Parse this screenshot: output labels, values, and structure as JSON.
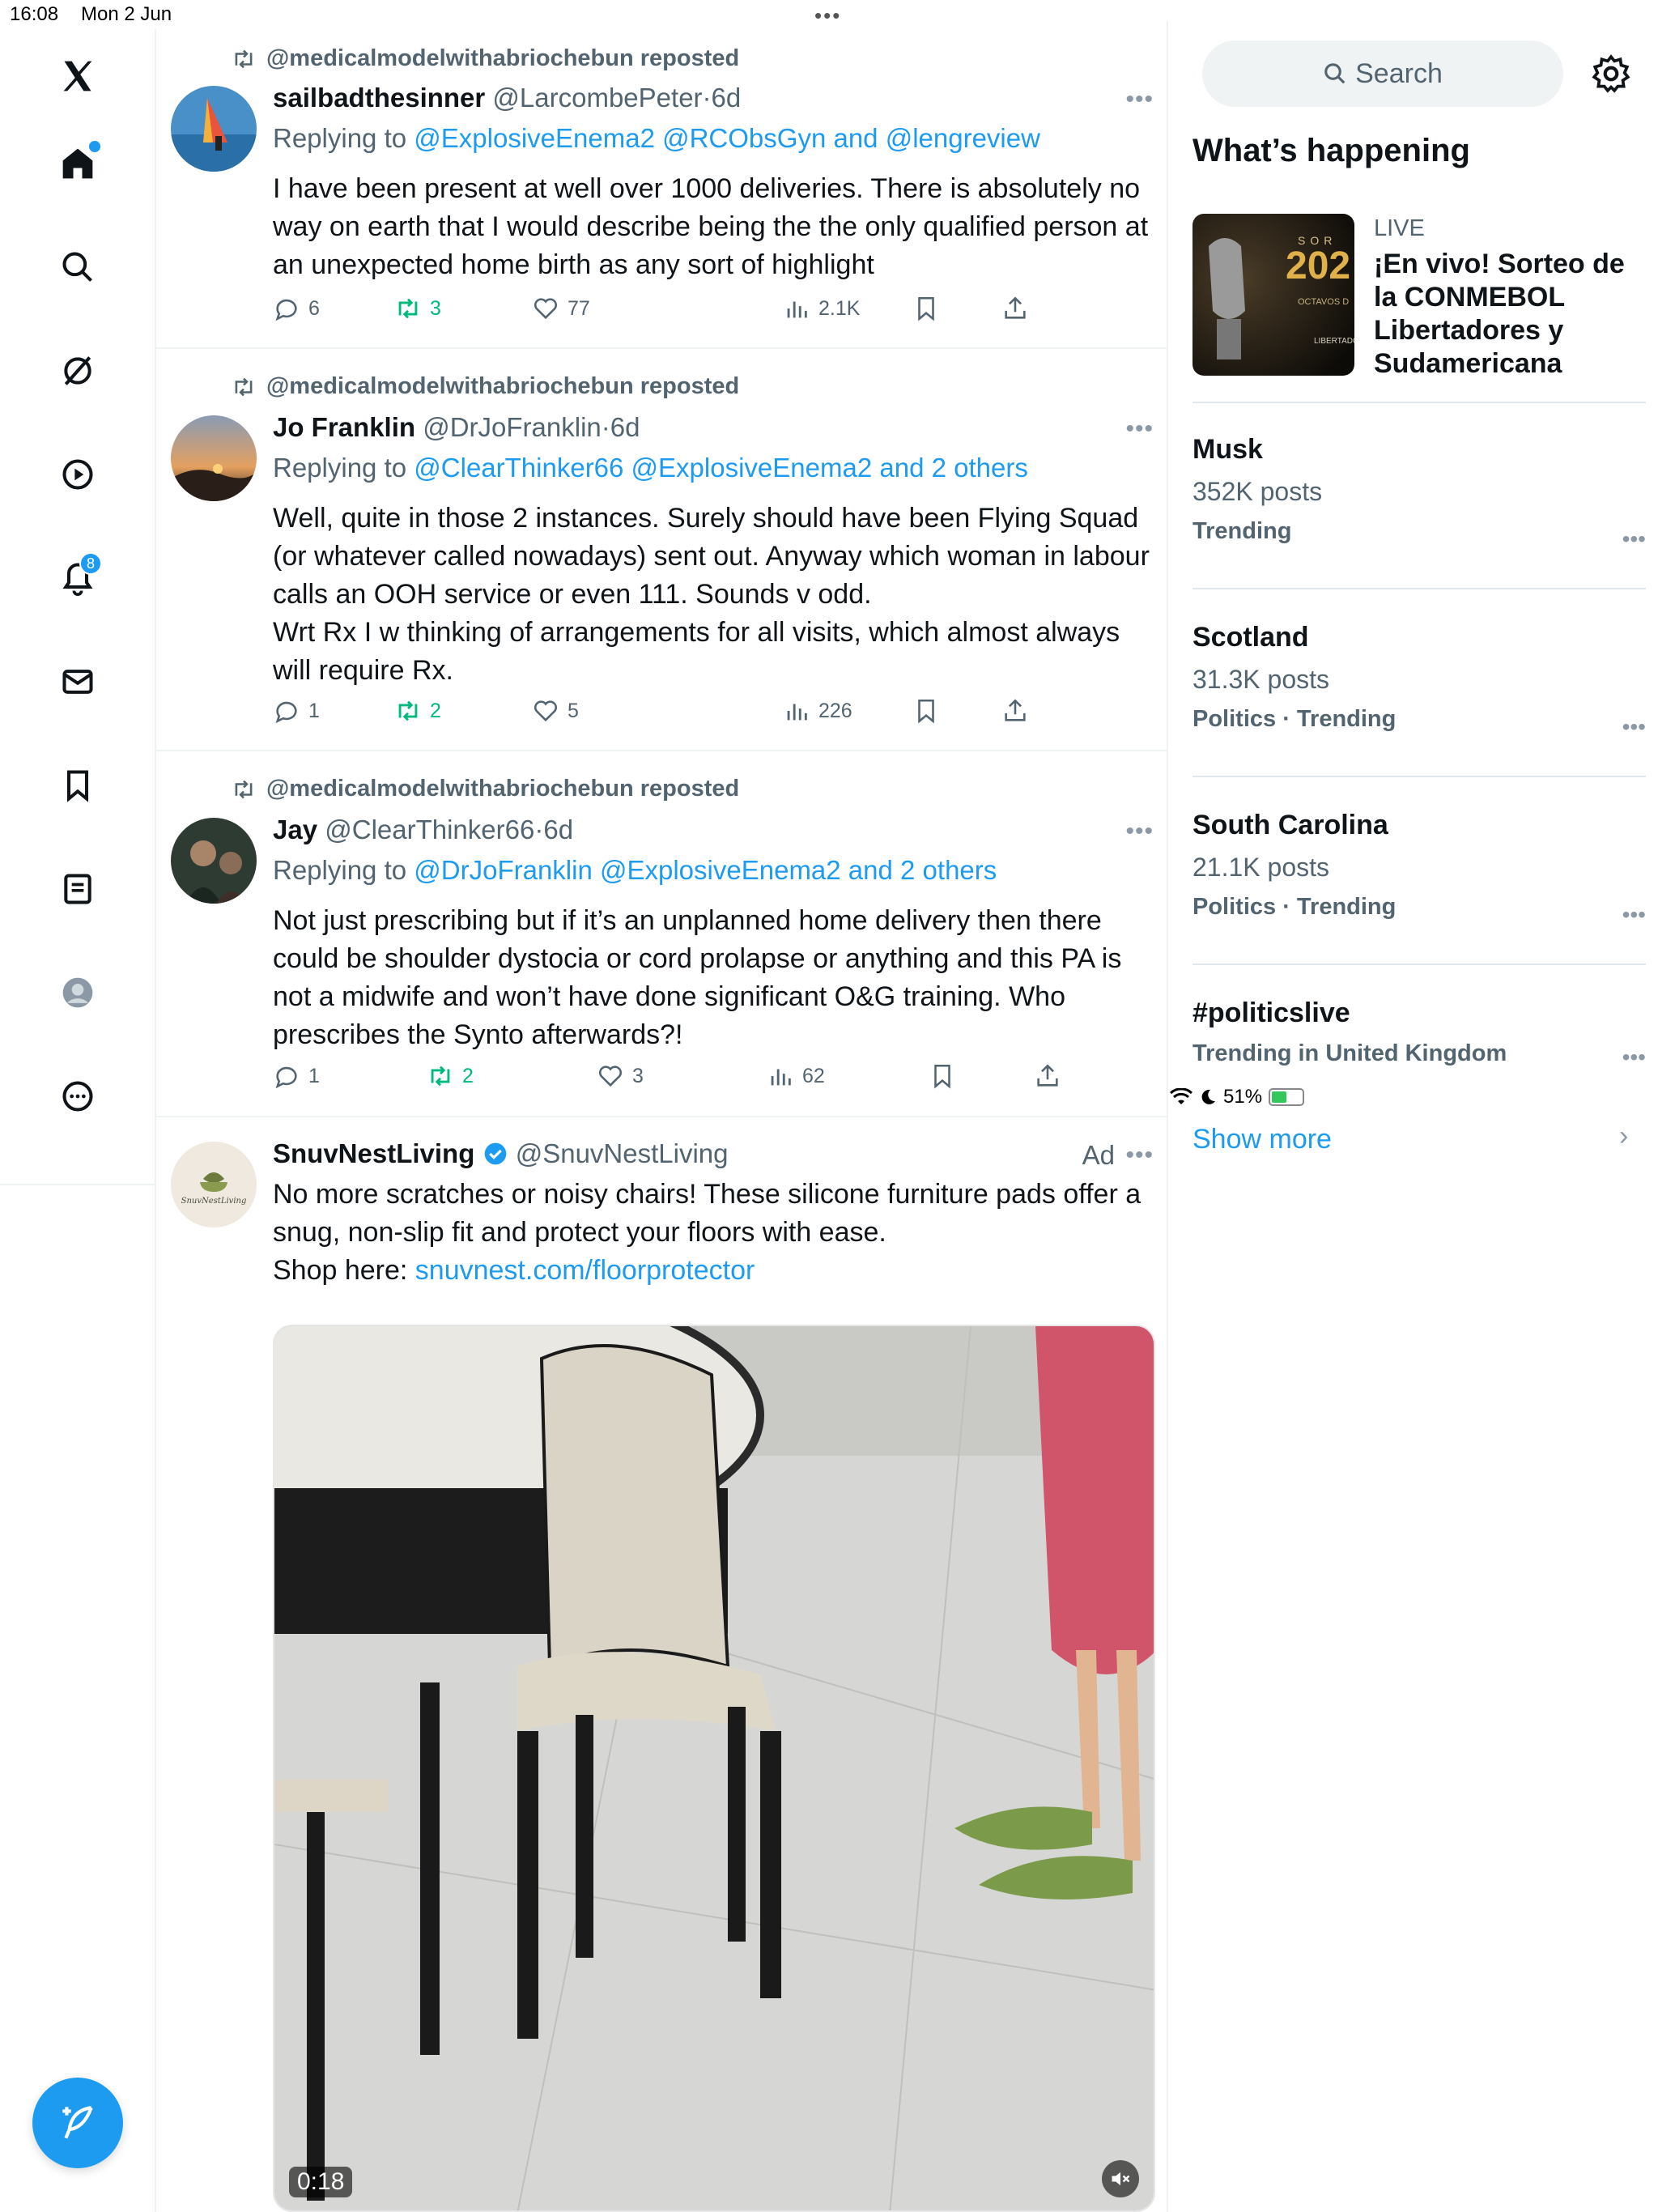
{
  "status_bar": {
    "time": "16:08",
    "date": "Mon 2 Jun",
    "battery": "51%",
    "battery_level": 0.51
  },
  "nav": {
    "notifications_badge": "8",
    "icons": [
      "x-logo-icon",
      "home-icon",
      "search-icon",
      "grok-icon",
      "video-icon",
      "notifications-icon",
      "messages-icon",
      "bookmarks-icon",
      "lists-icon",
      "profile-icon",
      "more-icon",
      "compose-icon"
    ]
  },
  "feed": {
    "posts": [
      {
        "repost_by": "@medicalmodelwithabriochebun reposted",
        "name": "sailbadthesinner",
        "handle": "@LarcombePeter",
        "time": "6d",
        "replying_prefix": "Replying to",
        "replying_to": "@ExplosiveEnema2 @RCObsGyn and @lengreview",
        "text": "I have been present at well over 1000 deliveries. There is absolutely no way on earth that I would describe being the the only qualified person at an unexpected home birth as any sort of highlight",
        "replies": "6",
        "reposts": "3",
        "likes": "77",
        "views": "2.1K"
      },
      {
        "repost_by": "@medicalmodelwithabriochebun reposted",
        "name": "Jo Franklin",
        "handle": "@DrJoFranklin",
        "time": "6d",
        "replying_prefix": "Replying to",
        "replying_to": "@ClearThinker66 @ExplosiveEnema2 and 2 others",
        "text": "Well, quite in those 2 instances. Surely should have been Flying Squad (or whatever called nowadays) sent out. Anyway which woman in labour calls an OOH service or even 111. Sounds v odd.\nWrt Rx I w thinking of arrangements for all visits, which almost always will require Rx.",
        "replies": "1",
        "reposts": "2",
        "likes": "5",
        "views": "226"
      },
      {
        "repost_by": "@medicalmodelwithabriochebun reposted",
        "name": "Jay",
        "handle": "@ClearThinker66",
        "time": "6d",
        "replying_prefix": "Replying to",
        "replying_to": "@DrJoFranklin @ExplosiveEnema2 and 2 others",
        "text": "Not just prescribing but if it’s an unplanned home delivery then there could be shoulder dystocia or cord prolapse or anything and this PA is not a midwife and won’t have done significant O&G training. Who prescribes the Synto afterwards?!",
        "replies": "1",
        "reposts": "2",
        "likes": "3",
        "views": "62"
      }
    ],
    "ad": {
      "name": "SnuvNestLiving",
      "handle": "@SnuvNestLiving",
      "ad_label": "Ad",
      "text": "No more scratches or noisy chairs! These silicone furniture pads offer a snug, non-slip fit and protect your floors with ease.\nShop here: ",
      "link": "snuvnest.com/floorprotector",
      "avatar_text": "SnuvNestLiving",
      "video_time": "0:18"
    }
  },
  "sidebar": {
    "search_placeholder": "Search",
    "section_title": "What’s happening",
    "live": {
      "label": "LIVE",
      "title": "¡En vivo! Sorteo de la CONMEBOL Libertadores y Sudamericana",
      "thumb_text_1": "SOR",
      "thumb_text_2": "202",
      "thumb_text_3": "OCTAVOS D",
      "thumb_text_4": "LIBERTADO"
    },
    "trends": [
      {
        "title": "Musk",
        "count": "352K posts",
        "meta": "Trending"
      },
      {
        "title": "Scotland",
        "count": "31.3K posts",
        "meta": "Politics · Trending"
      },
      {
        "title": "South Carolina",
        "count": "21.1K posts",
        "meta": "Politics · Trending"
      },
      {
        "title": "#politicslive",
        "count": "",
        "meta": "Trending in United Kingdom"
      }
    ],
    "show_more": "Show more"
  },
  "colors": {
    "accent": "#1d9bf0",
    "repost_green": "#00ba7c",
    "muted": "#536471"
  }
}
